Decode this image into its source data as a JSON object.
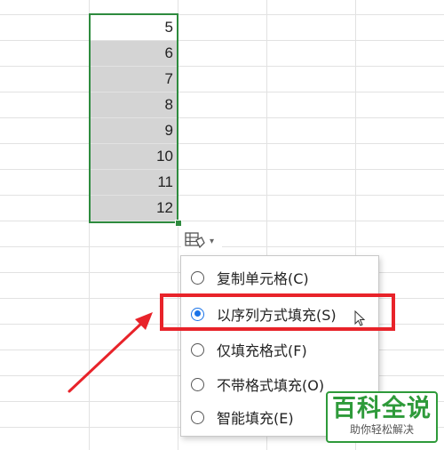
{
  "spreadsheet": {
    "column_values": [
      "5",
      "6",
      "7",
      "8",
      "9",
      "10",
      "11",
      "12"
    ]
  },
  "autofill_options": {
    "icon": "autofill-options-icon",
    "items": [
      {
        "label": "复制单元格(C)",
        "selected": false
      },
      {
        "label": "以序列方式填充(S)",
        "selected": true
      },
      {
        "label": "仅填充格式(F)",
        "selected": false
      },
      {
        "label": "不带格式填充(O)",
        "selected": false
      },
      {
        "label": "智能填充(E)",
        "selected": false
      }
    ]
  },
  "annotation": {
    "highlight_color": "#e8232a",
    "arrow_color": "#e8232a"
  },
  "watermark": {
    "main": "百科全说",
    "sub": "助你轻松解决"
  },
  "colors": {
    "selection_border": "#2e8b3e",
    "selected_cell_fill": "#d4d4d4",
    "radio_selected": "#1a73e8",
    "watermark_green": "#2e9a3a"
  }
}
